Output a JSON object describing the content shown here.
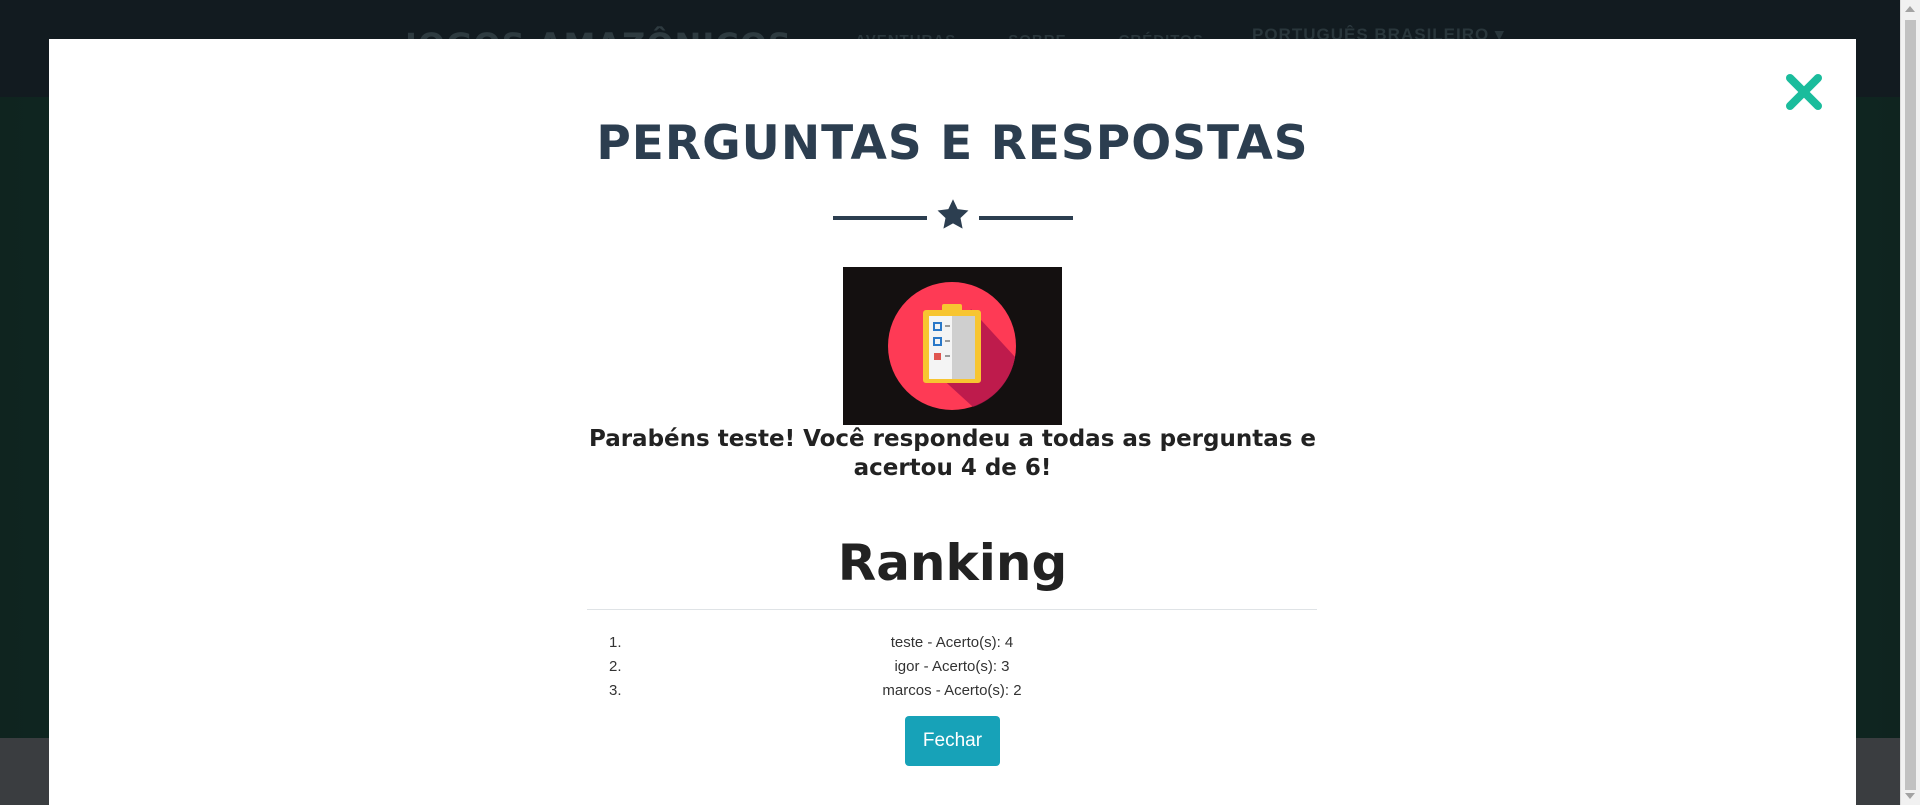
{
  "site": {
    "brand": "JOGOS AMAZÔNICOS",
    "nav": [
      "AVENTURAS",
      "SOBRE",
      "CRÉDITOS"
    ],
    "language": "PORTUGUÊS BRASILEIRO ▾"
  },
  "modal": {
    "title": "PERGUNTAS E RESPOSTAS",
    "close_icon": "close-x-icon",
    "divider_icon": "star-icon",
    "image_icon": "clipboard-checklist-icon",
    "congrats_text": "Parabéns teste! Você respondeu a todas as perguntas e acertou 4 de 6!",
    "ranking_title": "Ranking",
    "ranking": [
      {
        "num": "1.",
        "text": "teste - Acerto(s): 4"
      },
      {
        "num": "2.",
        "text": "igor - Acerto(s): 3"
      },
      {
        "num": "3.",
        "text": "marcos - Acerto(s): 2"
      }
    ],
    "close_button": "Fechar"
  },
  "colors": {
    "accent_close": "#1abc9c",
    "title": "#2c3e50",
    "button": "#17a2b8"
  }
}
